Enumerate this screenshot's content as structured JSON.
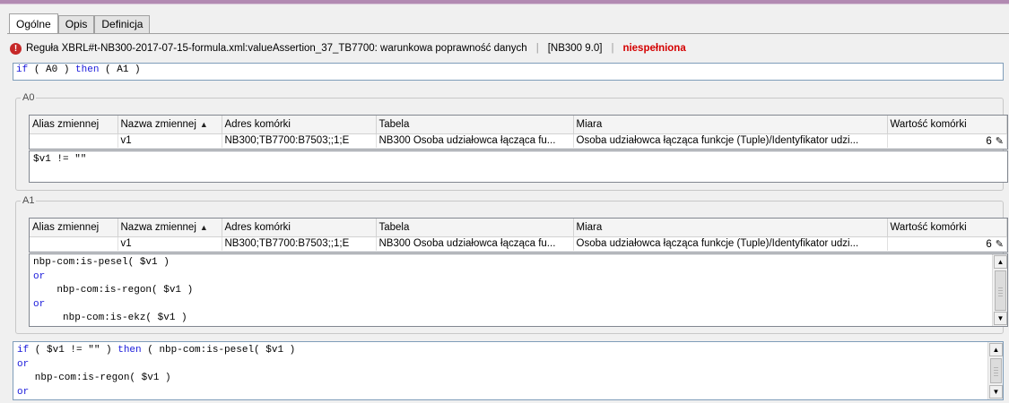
{
  "tabs": [
    {
      "label": "Ogólne",
      "active": true
    },
    {
      "label": "Opis",
      "active": false
    },
    {
      "label": "Definicja",
      "active": false
    }
  ],
  "status": {
    "icon": "error-icon",
    "rule": "Reguła XBRL#t-NB300-2017-07-15-formula.xml:valueAssertion_37_TB7700: warunkowa poprawność danych",
    "version": "[NB300 9.0]",
    "result": "niespełniona",
    "result_color": "#d40000"
  },
  "expression": {
    "if": "if",
    "a0": "( A0 )",
    "then": "then",
    "a1": "( A1 )"
  },
  "groups": [
    {
      "legend": "A0",
      "columns": [
        "Alias zmiennej",
        "Nazwa zmiennej",
        "Adres komórki",
        "Tabela",
        "Miara",
        "Wartość komórki"
      ],
      "rows": [
        {
          "alias": "",
          "name": "v1",
          "address": "NB300;TB7700:B7503;;1;E",
          "table": "NB300 Osoba udziałowca łącząca fu...",
          "measure": "Osoba udziałowca łącząca funkcje (Tuple)/Identyfikator udzi...",
          "value": "6"
        }
      ],
      "code": "$v1 != \"\""
    },
    {
      "legend": "A1",
      "columns": [
        "Alias zmiennej",
        "Nazwa zmiennej",
        "Adres komórki",
        "Tabela",
        "Miara",
        "Wartość komórki"
      ],
      "rows": [
        {
          "alias": "",
          "name": "v1",
          "address": "NB300;TB7700:B7503;;1;E",
          "table": "NB300 Osoba udziałowca łącząca fu...",
          "measure": "Osoba udziałowca łącząca funkcje (Tuple)/Identyfikator udzi...",
          "value": "6"
        }
      ],
      "code_lines": [
        "nbp-com:is-pesel( $v1 )",
        "or",
        "    nbp-com:is-regon( $v1 )",
        "or",
        "     nbp-com:is-ekz( $v1 )"
      ]
    }
  ],
  "bottom": {
    "line1_pre": "if",
    "line1_mid": " ( $v1 != \"\" ) ",
    "line1_then": "then",
    "line1_post": " ( nbp-com:is-pesel( $v1 )",
    "line2": "or",
    "line3": "   nbp-com:is-regon( $v1 )",
    "line4": "or"
  }
}
